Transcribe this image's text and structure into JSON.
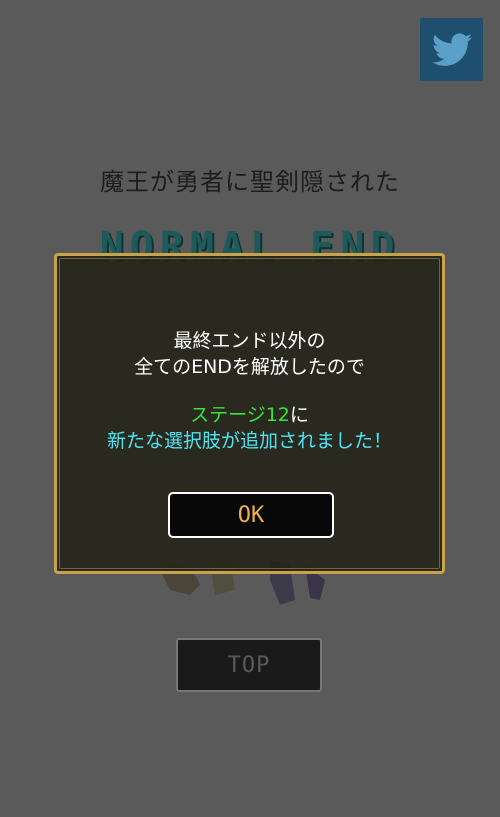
{
  "screen": {
    "ending_title": "魔王が勇者に聖剣隠された",
    "ending_name": "NORMAL END",
    "twitter_icon": "twitter-bird-icon",
    "top_button_label": "TOP"
  },
  "dialog": {
    "line1": "最終エンド以外の",
    "line2": "全てのENDを解放したので",
    "line3_highlight": "ステージ12",
    "line3_suffix": "に",
    "line4": "新たな選択肢が追加されました！",
    "ok_label": "OK"
  },
  "colors": {
    "dialog_border": "#c9a24a",
    "highlight_green": "#39e339",
    "highlight_cyan": "#4fe3f2",
    "ok_text": "#f0b24a",
    "twitter_bg": "#1f4f6f"
  }
}
